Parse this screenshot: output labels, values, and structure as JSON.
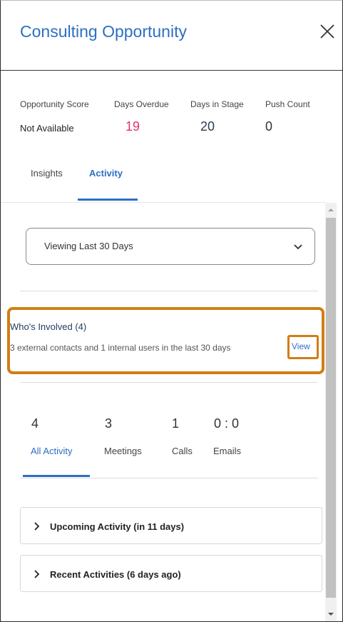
{
  "header": {
    "title": "Consulting Opportunity"
  },
  "metrics": [
    {
      "label": "Opportunity Score",
      "value": "Not Available"
    },
    {
      "label": "Days Overdue",
      "value": "19"
    },
    {
      "label": "Days in Stage",
      "value": "20"
    },
    {
      "label": "Push Count",
      "value": "0"
    }
  ],
  "tabs": [
    {
      "label": "Insights"
    },
    {
      "label": "Activity",
      "active": true
    }
  ],
  "filter": {
    "selected": "Viewing Last 30 Days"
  },
  "whos_involved": {
    "title": "Who's Involved (4)",
    "description": "3 external contacts and 1 internal users in the last 30 days",
    "view_link": "View"
  },
  "activity_stats": [
    {
      "count": "4",
      "label": "All Activity",
      "active": true
    },
    {
      "count": "3",
      "label": "Meetings"
    },
    {
      "count": "1",
      "label": "Calls"
    },
    {
      "count": "0 : 0",
      "label": "Emails"
    }
  ],
  "sections": [
    {
      "label": "Upcoming Activity (in 11 days)"
    },
    {
      "label": "Recent Activities (6 days ago)"
    }
  ],
  "colors": {
    "accent": "#2d6fc3",
    "overdue": "#e0336e",
    "highlight": "#d17e14"
  }
}
